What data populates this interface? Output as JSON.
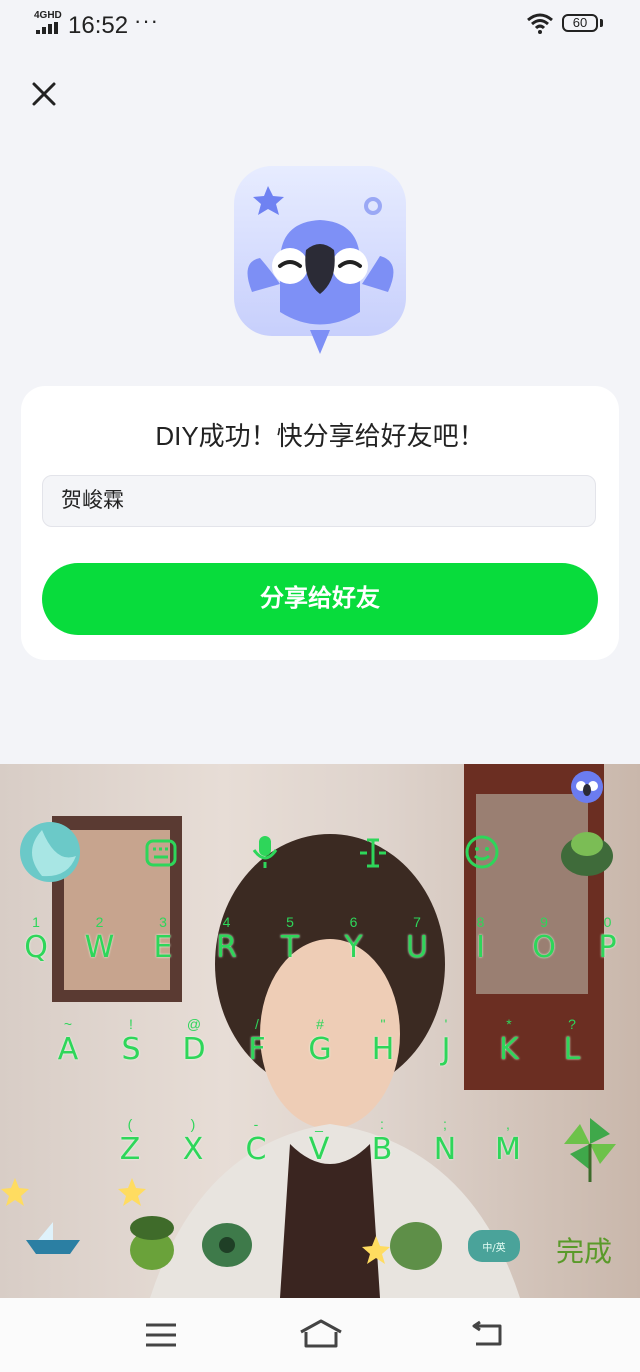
{
  "status_bar": {
    "network": "4GHD",
    "time": "16:52",
    "more": "···",
    "battery": "60",
    "icons": [
      "signal-icon",
      "wifi-icon",
      "battery-icon"
    ]
  },
  "header": {
    "close_icon": "close-icon"
  },
  "mascot": {
    "icon": "bird-mascot-icon"
  },
  "card": {
    "title": "DIY成功！快分享给好友吧！",
    "name_value": "贺峻霖",
    "share_button": "分享给好友"
  },
  "keyboard": {
    "toolbar": [
      "logo-icon",
      "keyboard-icon",
      "mic-icon",
      "cursor-icon",
      "emoji-icon",
      "theme-icon"
    ],
    "row1": [
      "Q",
      "W",
      "E",
      "R",
      "T",
      "Y",
      "U",
      "I",
      "O",
      "P"
    ],
    "row1_sub": [
      "1",
      "2",
      "3",
      "4",
      "5",
      "6",
      "7",
      "8",
      "9",
      "0"
    ],
    "row2": [
      "A",
      "S",
      "D",
      "F",
      "G",
      "H",
      "J",
      "K",
      "L"
    ],
    "row2_sub": [
      "~",
      "!",
      "@",
      "/",
      "#",
      "\"",
      "'",
      "*",
      "?"
    ],
    "row3": [
      "Z",
      "X",
      "C",
      "V",
      "B",
      "N",
      "M"
    ],
    "row3_sub": [
      "(",
      ")",
      "-",
      "_",
      ":",
      ";",
      ","
    ],
    "done": "完成",
    "language_key": "中/英"
  },
  "colors": {
    "accent_green": "#08dc3c",
    "key_green": "#2ed65a",
    "page_bg": "#f3f4f8"
  },
  "navbar": {
    "icons": [
      "menu-icon",
      "home-icon",
      "back-icon"
    ]
  }
}
